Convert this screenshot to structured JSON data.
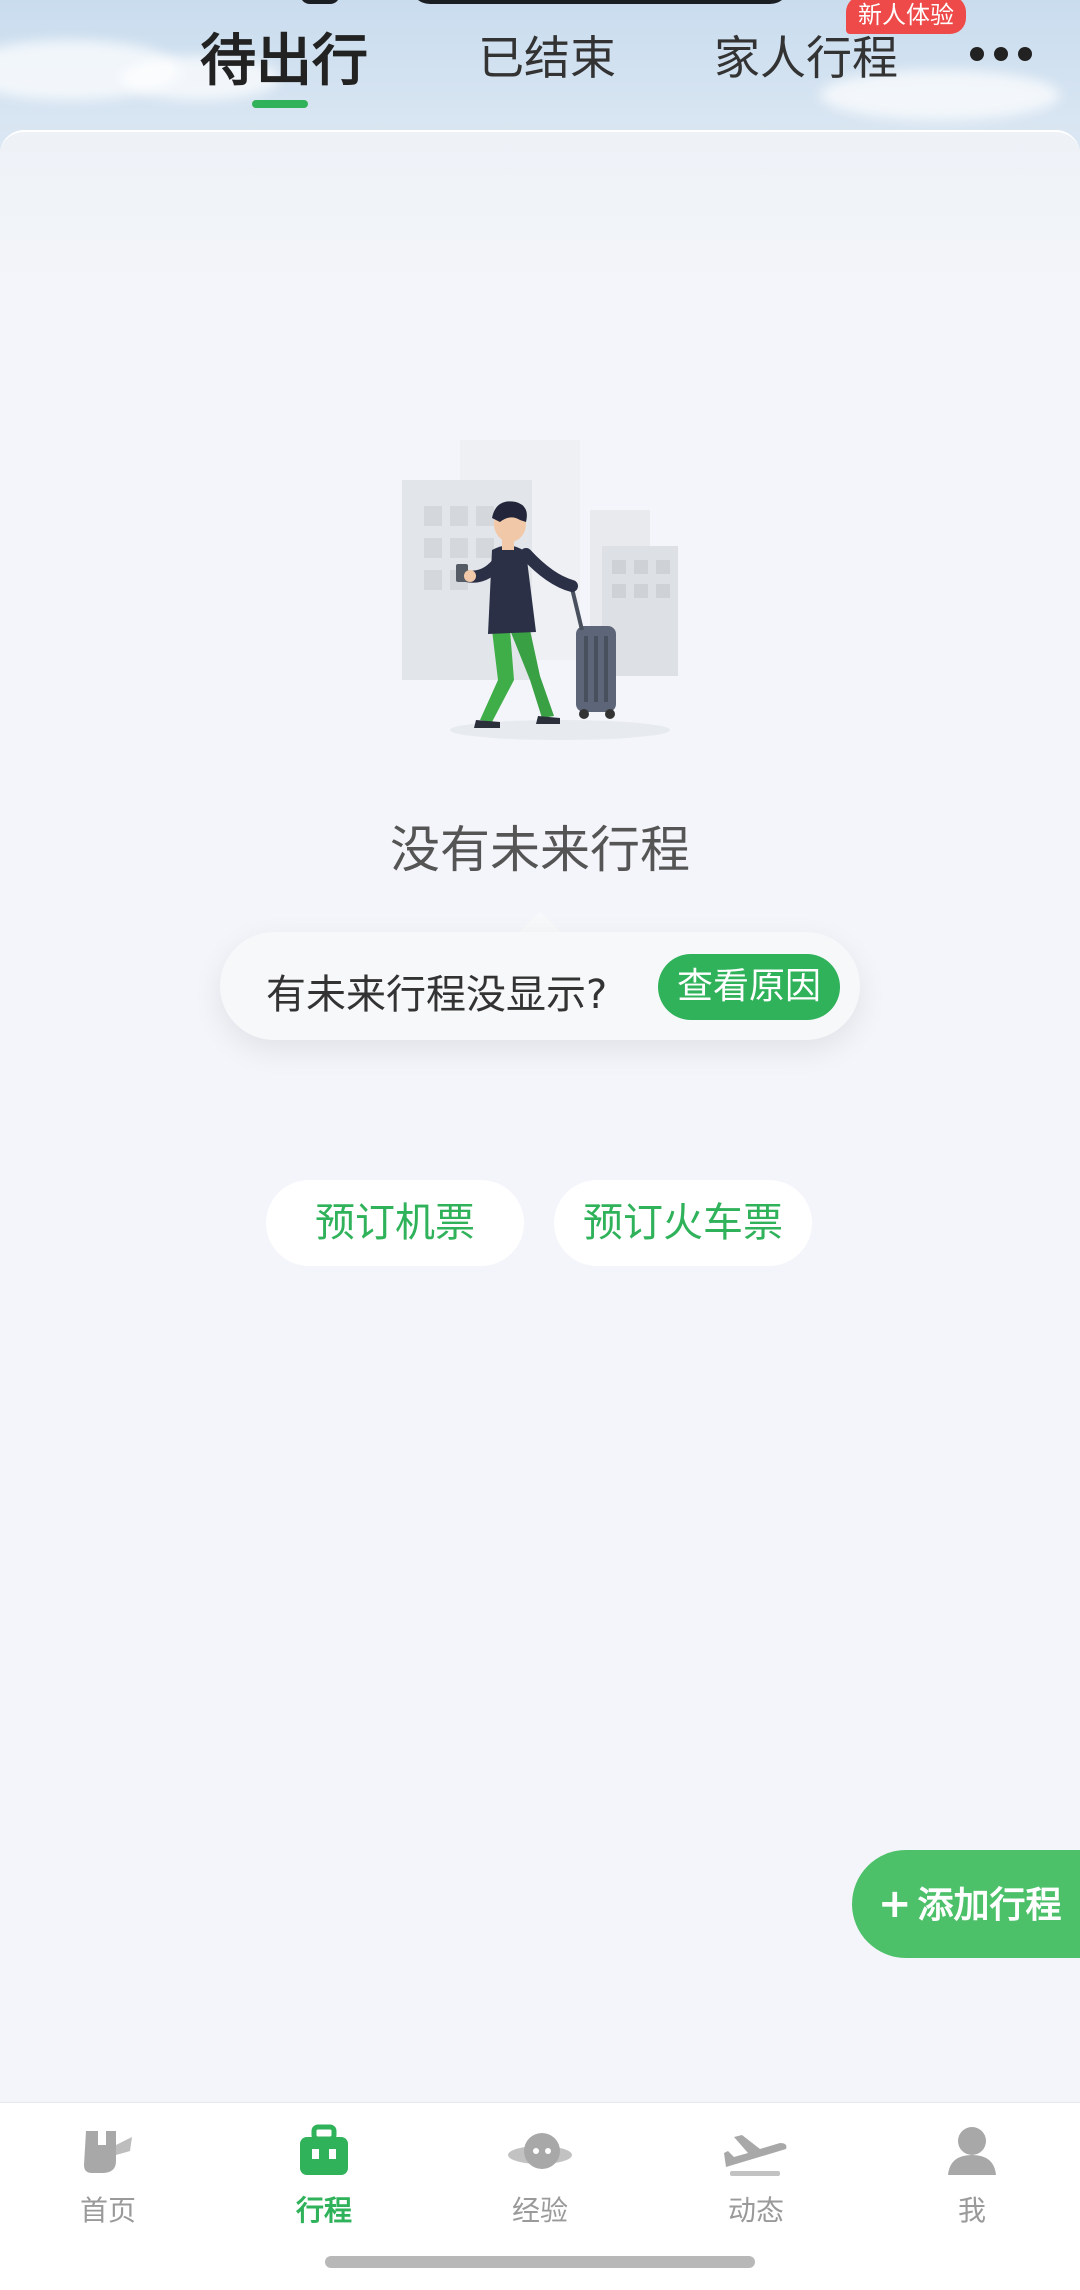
{
  "tabs": [
    {
      "label": "待出行",
      "active": true
    },
    {
      "label": "已结束",
      "active": false
    },
    {
      "label": "家人行程",
      "active": false
    }
  ],
  "badge": {
    "new_user": "新人体验"
  },
  "icons": {
    "more": "more-dots-icon",
    "illustration": "traveler-with-suitcase-illustration",
    "plus": "plus-icon"
  },
  "empty_state": {
    "title": "没有未来行程",
    "tip_text": "有未来行程没显示?",
    "tip_button": "查看原因"
  },
  "actions": {
    "book_flight": "预订机票",
    "book_train": "预订火车票",
    "add_trip": "添加行程"
  },
  "tabbar": [
    {
      "label": "首页",
      "icon": "home-icon",
      "active": false
    },
    {
      "label": "行程",
      "icon": "briefcase-icon",
      "active": true
    },
    {
      "label": "经验",
      "icon": "planet-icon",
      "active": false
    },
    {
      "label": "动态",
      "icon": "plane-icon",
      "active": false
    },
    {
      "label": "我",
      "icon": "profile-icon",
      "active": false
    }
  ],
  "colors": {
    "accent": "#2fb25a",
    "badge": "#ef4a4a",
    "inactive": "#9a9a9a"
  }
}
